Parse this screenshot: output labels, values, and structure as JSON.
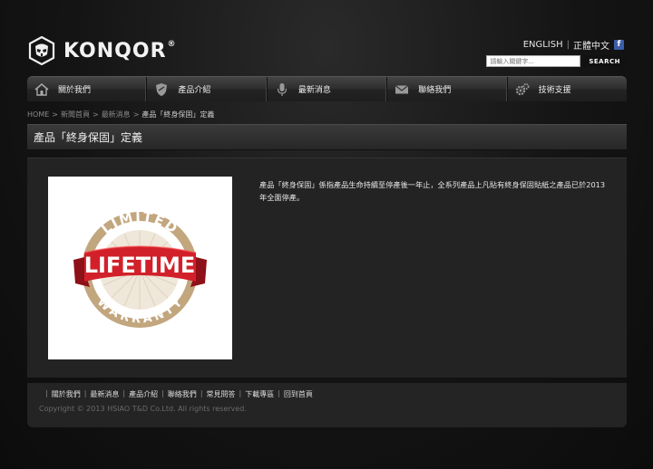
{
  "header": {
    "brand": "KONQOR",
    "registered": "®",
    "lang_english": "ENGLISH",
    "lang_chinese": "正體中文",
    "lang_separator": "|",
    "facebook_glyph": "f",
    "search_placeholder": "請輸入關鍵字...",
    "search_button": "SEARCH"
  },
  "nav": {
    "items": [
      {
        "label": "關於我們",
        "icon": "home-icon"
      },
      {
        "label": "產品介紹",
        "icon": "shield-icon"
      },
      {
        "label": "最新消息",
        "icon": "microphone-icon"
      },
      {
        "label": "聯絡我們",
        "icon": "mail-icon"
      },
      {
        "label": "技術支援",
        "icon": "gears-icon"
      }
    ]
  },
  "breadcrumb": {
    "home": "HOME",
    "news_home": "新聞首頁",
    "latest_news": "最新消息",
    "current": "產品「終身保固」定義",
    "separator": ">"
  },
  "page": {
    "title": "產品「終身保固」定義",
    "description": "產品「終身保固」係指產品生命持續至停產後一年止，全系列產品上凡貼有終身保固貼紙之產品已於2013年全面停產。",
    "image": {
      "top_text": "LIMITED",
      "ribbon_text": "LIFETIME",
      "bottom_text": "WARRANTY"
    }
  },
  "footer": {
    "links": [
      "關於我們",
      "最新消息",
      "產品介紹",
      "聯絡我們",
      "常見問答",
      "下載專區",
      "回到首頁"
    ],
    "separator": "|",
    "copyright": "Copyright © 2013 HSIAO T&D Co.Ltd. All rights reserved."
  },
  "colors": {
    "badge_tan": "#c2a67e",
    "ribbon_red": "#d2202a",
    "facebook": "#3b5ea8"
  }
}
